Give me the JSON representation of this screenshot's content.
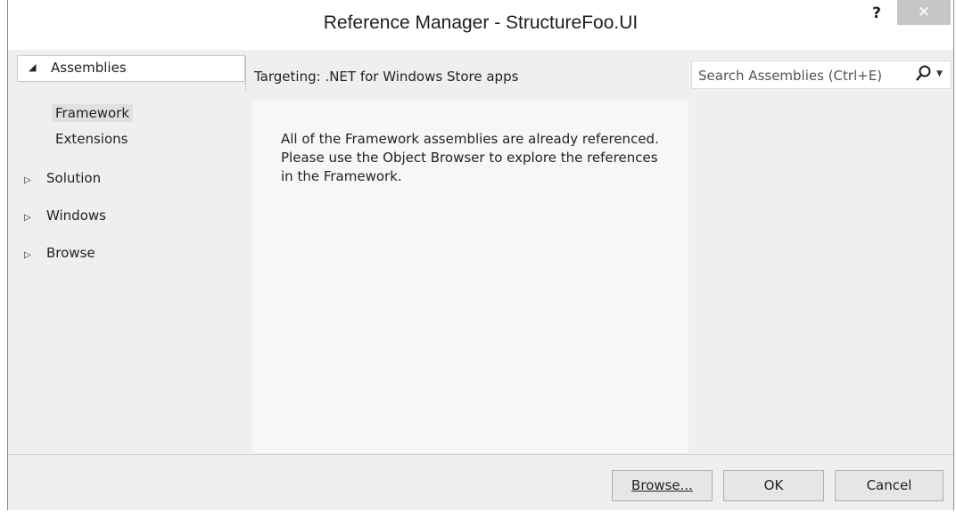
{
  "window": {
    "title": "Reference Manager - StructureFoo.UI",
    "help_label": "?",
    "close_label": "✕"
  },
  "sidebar": {
    "assemblies": {
      "arrow": "◢",
      "label": "Assemblies"
    },
    "assemblies_children": [
      {
        "label": "Framework"
      },
      {
        "label": "Extensions"
      }
    ],
    "collapsed": [
      {
        "arrow": "▷",
        "label": "Solution"
      },
      {
        "arrow": "▷",
        "label": "Windows"
      },
      {
        "arrow": "▷",
        "label": "Browse"
      }
    ]
  },
  "header": {
    "targeting": "Targeting: .NET for Windows Store apps"
  },
  "search": {
    "placeholder": "Search Assemblies (Ctrl+E)",
    "icon": "search-icon",
    "dropdown_arrow": "▼"
  },
  "content": {
    "message": "All of the Framework assemblies are already referenced. Please use the Object Browser to explore the references in the Framework."
  },
  "footer": {
    "browse_label": "Browse...",
    "ok_label": "OK",
    "cancel_label": "Cancel"
  }
}
